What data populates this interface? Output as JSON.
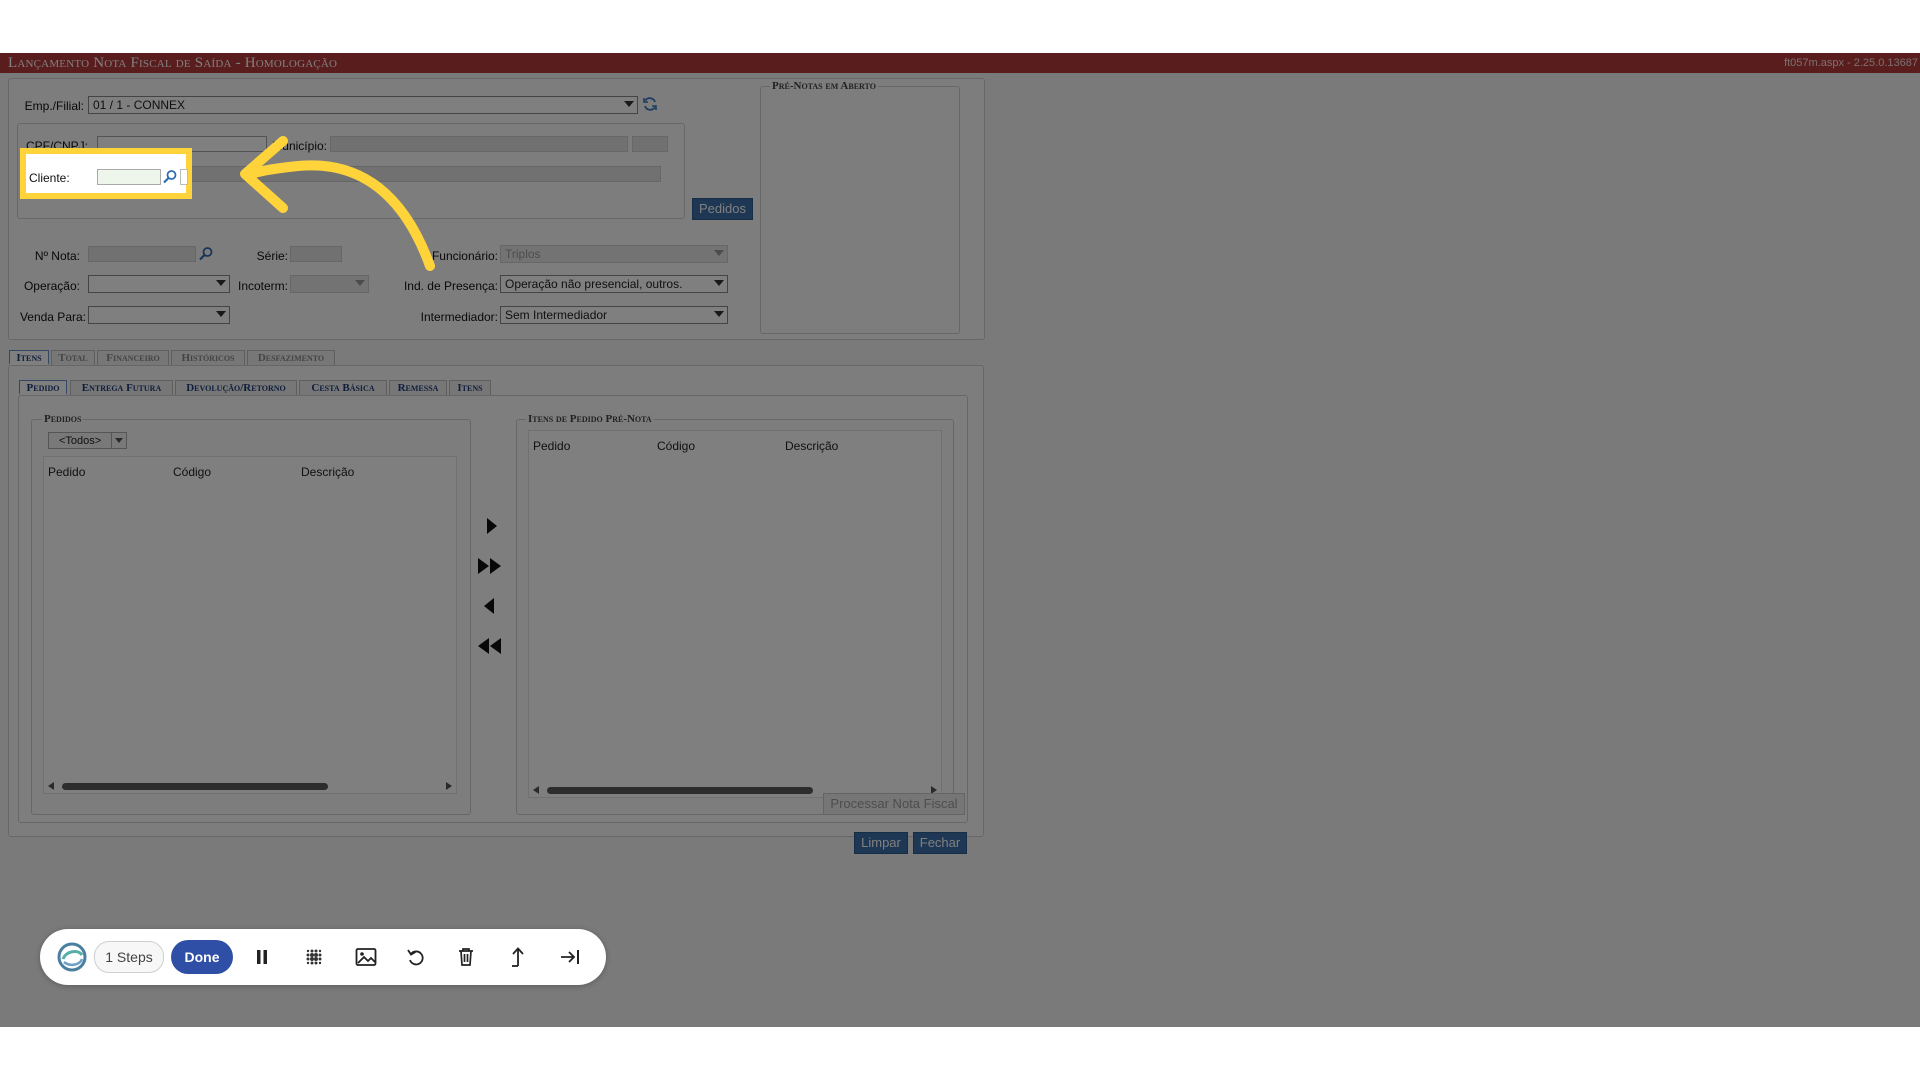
{
  "window": {
    "title": "Lançamento Nota Fiscal de Saída  - Homologação",
    "page_id": "ft057m.aspx - 2.25.0.13687"
  },
  "form": {
    "empresa_label": "Emp./Filial:",
    "empresa_value": "01 / 1 - CONNEX",
    "cpf_label": "CPF/CNPJ:",
    "municipio_label": "Município:",
    "cliente_label": "Cliente:",
    "nota_label": "Nº Nota:",
    "serie_label": "Série:",
    "funcionario_label": "Funcionário:",
    "funcionario_value": "Triplos",
    "operacao_label": "Operação:",
    "incoterm_label": "Incoterm:",
    "ind_presenca_label": "Ind. de Presença:",
    "ind_presenca_value": "Operação não presencial, outros.",
    "venda_label": "Venda Para:",
    "intermediador_label": "Intermediador:",
    "intermediador_value": "Sem Intermediador",
    "pedidos_button": "Pedidos"
  },
  "prenotas": {
    "legend": "Pré-Notas em Aberto"
  },
  "main_tabs": [
    "Itens",
    "Total",
    "Financeiro",
    "Históricos",
    "Desfazimento"
  ],
  "sub_tabs": [
    "Pedido",
    "Entrega Futura",
    "Devolução/Retorno",
    "Cesta Básica",
    "Remessa",
    "Itens"
  ],
  "pedidos_panel": {
    "legend": "Pedidos",
    "filter_value": "<Todos>",
    "columns": [
      "Pedido",
      "Código",
      "Descrição"
    ]
  },
  "itens_panel": {
    "legend": "Itens de Pedido Pré-Nota",
    "columns": [
      "Pedido",
      "Código",
      "Descrição"
    ]
  },
  "actions": {
    "processar": "Processar Nota Fiscal",
    "limpar": "Limpar",
    "fechar": "Fechar"
  },
  "recorder": {
    "steps": "1 Steps",
    "done": "Done",
    "icons": [
      "logo-icon",
      "pause-icon",
      "blur-icon",
      "image-icon",
      "undo-icon",
      "trash-icon",
      "export-icon",
      "skip-end-icon"
    ]
  },
  "colors": {
    "titlebar": "#b43a3a",
    "primary_button": "#3d6fa8",
    "highlight": "#ffd43b",
    "done_button": "#2f4fa7"
  }
}
